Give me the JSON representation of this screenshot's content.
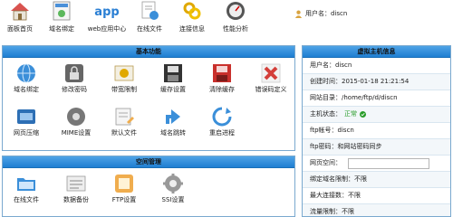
{
  "toolbar": {
    "items": [
      {
        "label": "面板首页",
        "icon": "home-icon"
      },
      {
        "label": "域名绑定",
        "icon": "domain-icon"
      },
      {
        "label": "web应用中心",
        "icon": "app-icon",
        "icon_text": "app"
      },
      {
        "label": "在线文件",
        "icon": "online-file-icon"
      },
      {
        "label": "连接信息",
        "icon": "connection-info-icon"
      },
      {
        "label": "性能分析",
        "icon": "performance-icon"
      }
    ],
    "user_label": "用户名：discn"
  },
  "basic": {
    "title": "基本功能",
    "items": [
      {
        "label": "域名绑定",
        "icon": "globe-icon"
      },
      {
        "label": "修改密码",
        "icon": "lock-icon"
      },
      {
        "label": "带宽限制",
        "icon": "bandwidth-icon"
      },
      {
        "label": "缓存设置",
        "icon": "cache-icon"
      },
      {
        "label": "清除缓存",
        "icon": "clear-cache-icon"
      },
      {
        "label": "错误码定义",
        "icon": "error-icon"
      },
      {
        "label": "网页压缩",
        "icon": "compress-icon"
      },
      {
        "label": "MIME设置",
        "icon": "mime-icon"
      },
      {
        "label": "默认文件",
        "icon": "default-file-icon"
      },
      {
        "label": "域名跳转",
        "icon": "redirect-icon"
      },
      {
        "label": "重启进程",
        "icon": "restart-icon"
      }
    ]
  },
  "space": {
    "title": "空间管理",
    "items": [
      {
        "label": "在线文件",
        "icon": "folder-icon"
      },
      {
        "label": "数据备份",
        "icon": "backup-icon"
      },
      {
        "label": "FTP设置",
        "icon": "ftp-icon"
      },
      {
        "label": "SSI设置",
        "icon": "ssi-gear-icon"
      }
    ]
  },
  "host": {
    "title": "虚拟主机信息",
    "rows": [
      "用户名：discn",
      "创建时间：2015-01-18 21:21:54",
      "网站目录：/home/ftp/d/discn",
      "主机状态：",
      "ftp帐号：discn",
      "ftp密码：和网站密码同步",
      "网页空间：",
      "绑定域名限制：不限",
      "最大连接数：不限",
      "流量限制：不限"
    ],
    "status_value": "正常",
    "colors": {
      "status": "#2a9d2a",
      "accent": "#1f7ed2",
      "border": "#7aa9cf"
    }
  }
}
